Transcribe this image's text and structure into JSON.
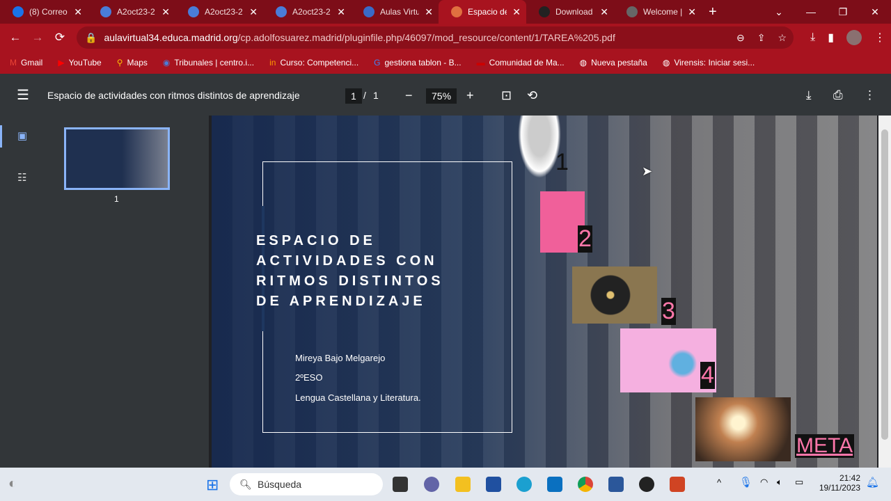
{
  "tabs": [
    {
      "label": "(8) Correo",
      "color": "#1a73e8"
    },
    {
      "label": "A2oct23-2",
      "color": "#4a7cd8"
    },
    {
      "label": "A2oct23-2",
      "color": "#4a7cd8"
    },
    {
      "label": "A2oct23-2",
      "color": "#4a7cd8"
    },
    {
      "label": "Aulas Virtu",
      "color": "#3a6ac8"
    },
    {
      "label": "Espacio de",
      "color": "#e07040"
    },
    {
      "label": "Download",
      "color": "#222"
    },
    {
      "label": "Welcome |",
      "color": "#666"
    }
  ],
  "url": {
    "host": "aulavirtual34.educa.madrid.org",
    "path": "/cp.adolfosuarez.madrid/pluginfile.php/46097/mod_resource/content/1/TAREA%205.pdf"
  },
  "bookmarks": [
    "Gmail",
    "YouTube",
    "Maps",
    "Tribunales | centro.i...",
    "Curso: Competenci...",
    "gestiona tablon - B...",
    "Comunidad de Ma...",
    "Nueva pestaña",
    "Virensis: Iniciar sesi..."
  ],
  "pdf": {
    "title": "Espacio de actividades con ritmos distintos de aprendizaje",
    "page": "1",
    "total": "1",
    "zoom": "75%",
    "thumb_label": "1"
  },
  "slide": {
    "title_lines": [
      "ESPACIO DE",
      "ACTIVIDADES CON",
      "RITMOS DISTINTOS",
      "DE APRENDIZAJE"
    ],
    "author": "Mireya Bajo Melgarejo",
    "course": "2ºESO",
    "subject": "Lengua Castellana y Literatura.",
    "steps": [
      "1",
      "2",
      "3",
      "4"
    ],
    "goal": "META"
  },
  "taskbar": {
    "search": "Búsqueda",
    "time": "21:42",
    "date": "19/11/2023"
  }
}
